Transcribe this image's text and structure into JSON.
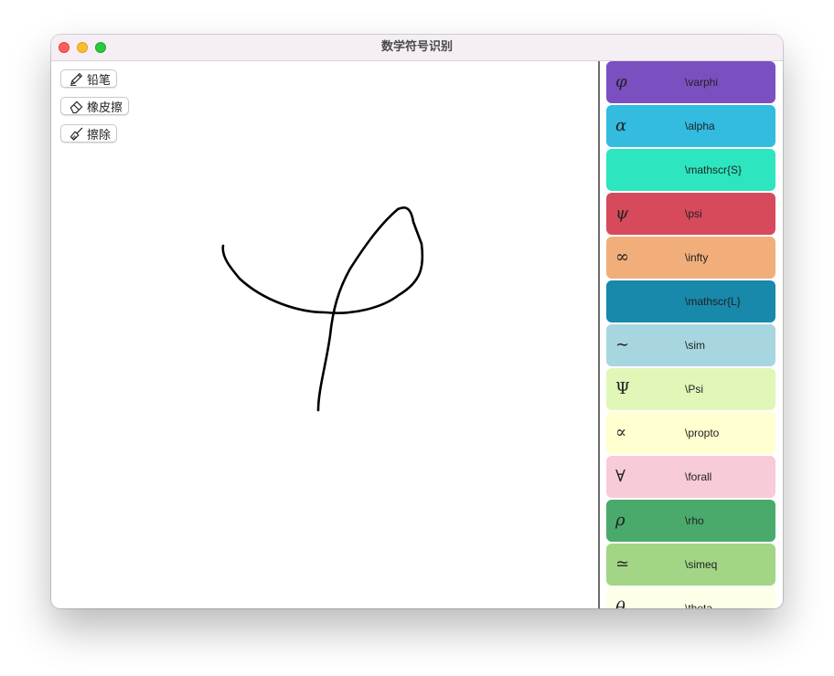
{
  "window": {
    "title": "数学符号识别"
  },
  "toolbar": {
    "pencil_label": "铅笔",
    "eraser_label": "橡皮擦",
    "clear_label": "擦除"
  },
  "results": [
    {
      "symbol": "φ",
      "latex": "\\varphi",
      "color": "#7b4fc0",
      "italic": true
    },
    {
      "symbol": "α",
      "latex": "\\alpha",
      "color": "#33bbe0",
      "italic": true
    },
    {
      "symbol": "",
      "latex": "\\mathscr{S}",
      "color": "#2de6c0",
      "italic": false
    },
    {
      "symbol": "ψ",
      "latex": "\\psi",
      "color": "#d64a5c",
      "italic": true
    },
    {
      "symbol": "∞",
      "latex": "\\infty",
      "color": "#f2ae7a",
      "italic": false
    },
    {
      "symbol": "",
      "latex": "\\mathscr{L}",
      "color": "#1888ab",
      "italic": false
    },
    {
      "symbol": "∼",
      "latex": "\\sim",
      "color": "#a8d6e0",
      "italic": false
    },
    {
      "symbol": "Ψ",
      "latex": "\\Psi",
      "color": "#e0f7b8",
      "italic": false
    },
    {
      "symbol": "∝",
      "latex": "\\propto",
      "color": "#ffffd0",
      "italic": false
    },
    {
      "symbol": "∀",
      "latex": "\\forall",
      "color": "#f7cbd8",
      "italic": false
    },
    {
      "symbol": "ρ",
      "latex": "\\rho",
      "color": "#4aaa6c",
      "italic": true
    },
    {
      "symbol": "≃",
      "latex": "\\simeq",
      "color": "#a2d686",
      "italic": false
    },
    {
      "symbol": "θ",
      "latex": "\\theta",
      "color": "#feffe8",
      "italic": true
    }
  ]
}
